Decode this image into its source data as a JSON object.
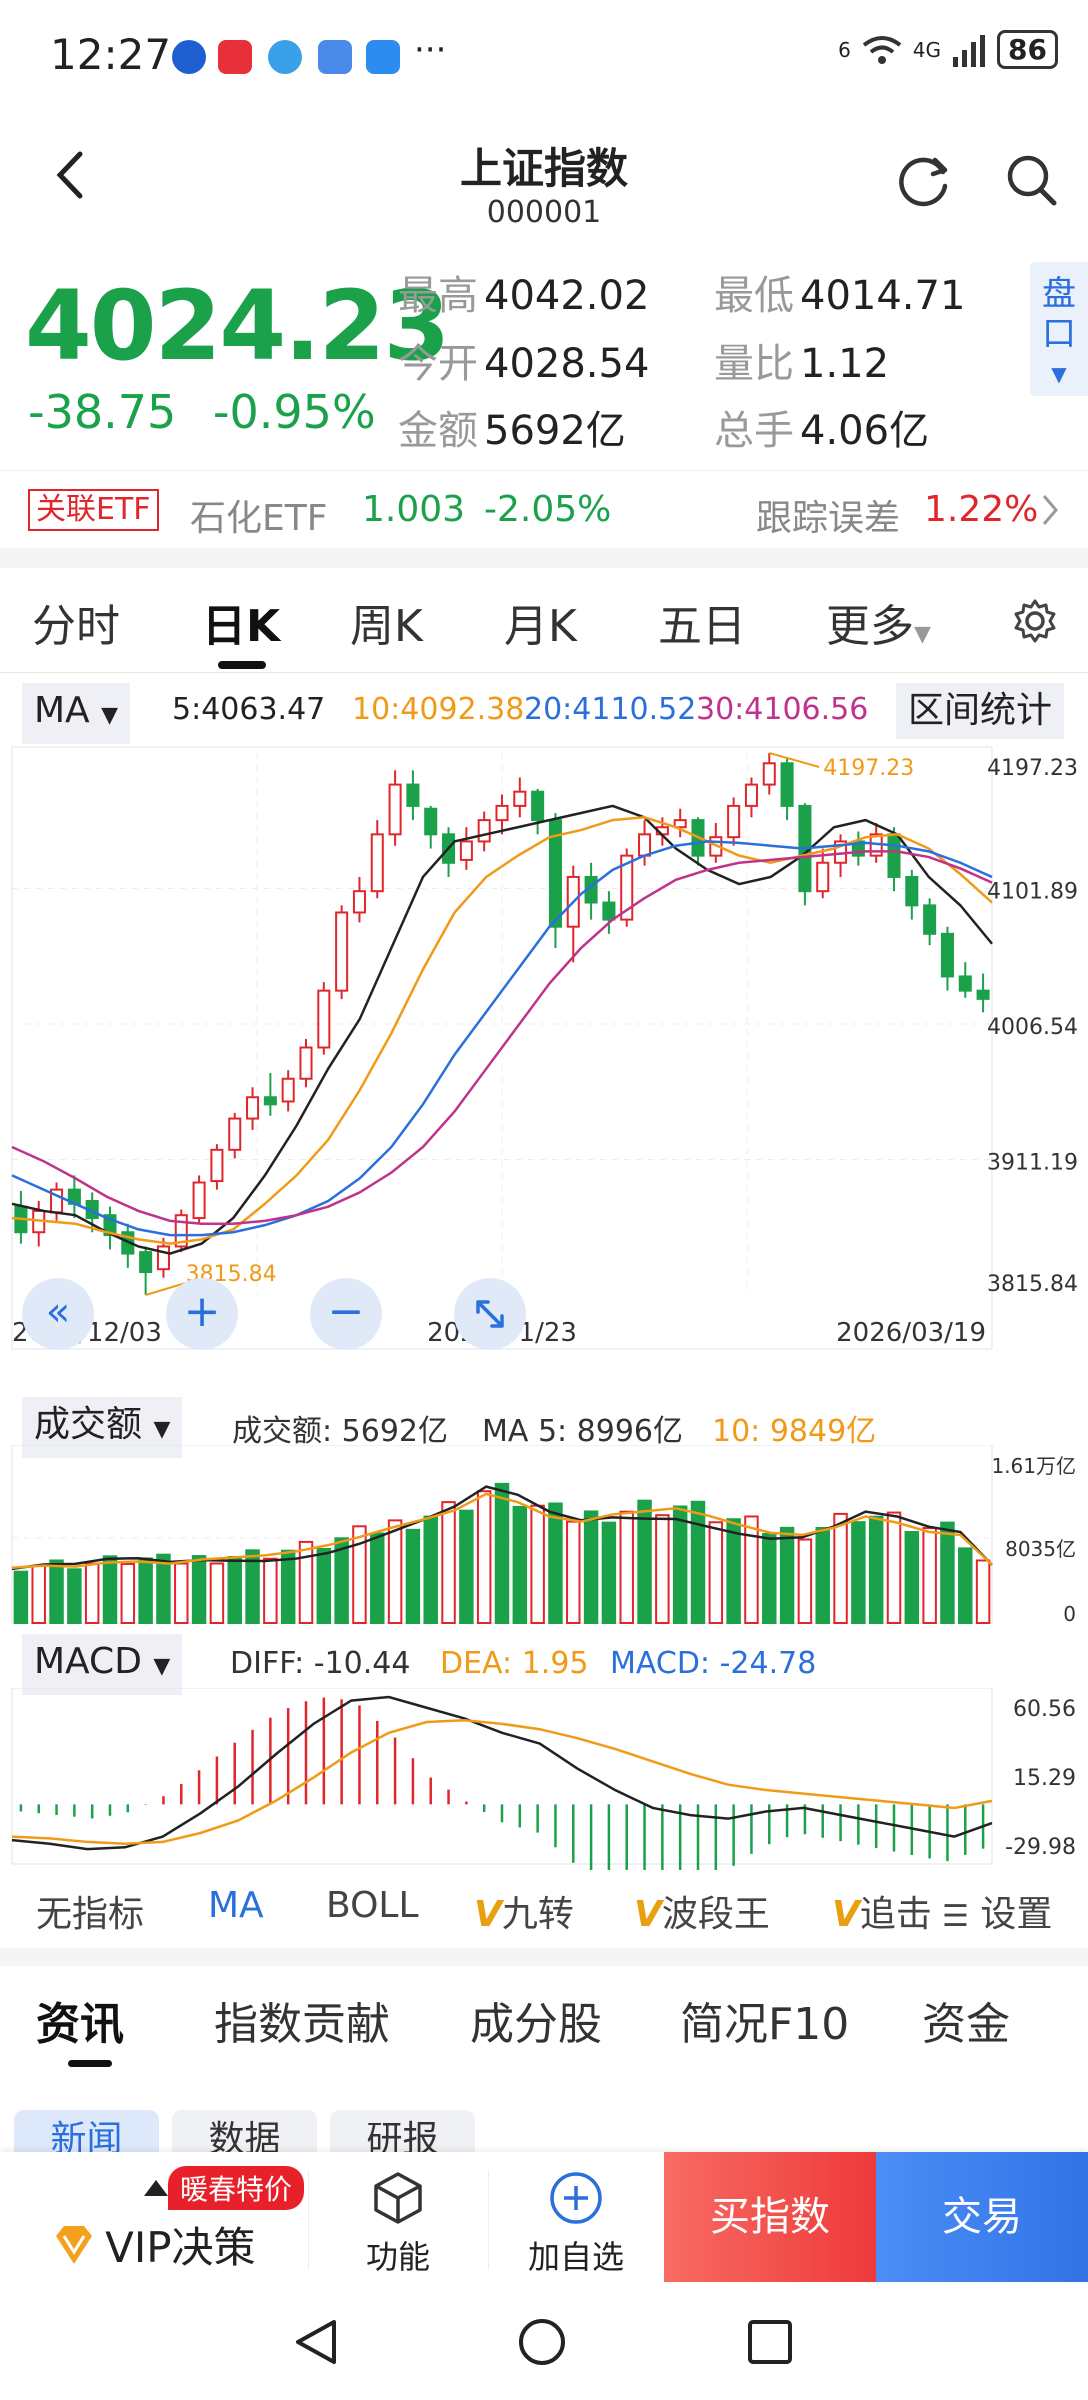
{
  "status_bar": {
    "time": "12:27",
    "more": "···",
    "net_badge": "6",
    "signal_label": "4G",
    "battery": "86"
  },
  "header": {
    "title": "上证指数",
    "code": "000001"
  },
  "quote": {
    "price": "4024.23",
    "change": "-38.75",
    "change_pct": "-0.95%",
    "high_label": "最高",
    "high": "4042.02",
    "low_label": "最低",
    "low": "4014.71",
    "open_label": "今开",
    "open": "4028.54",
    "volume_ratio_label": "量比",
    "volume_ratio": "1.12",
    "amount_label": "金额",
    "amount": "5692亿",
    "total_hands_label": "总手",
    "total_hands": "4.06亿",
    "pankou_label": "盘口"
  },
  "etf": {
    "tag": "关联ETF",
    "name": "石化ETF",
    "price": "1.003",
    "change_pct": "-2.05%",
    "tracking_label": "跟踪误差",
    "tracking_value": "1.22%"
  },
  "period_tabs": [
    "分时",
    "日K",
    "周K",
    "月K",
    "五日",
    "更多"
  ],
  "active_period": "日K",
  "ma_legend": {
    "selector": "MA",
    "ma5": "5:4063.47",
    "ma10": "10:4092.38",
    "ma20": "20:4110.52",
    "ma30": "30:4106.56",
    "range_stat": "区间统计"
  },
  "kline": {
    "y_labels": [
      "4197.23",
      "4101.89",
      "4006.54",
      "3911.19",
      "3815.84"
    ],
    "x_labels": [
      "2025/12/03",
      "2026/01/23",
      "2026/03/19"
    ],
    "max_annotation": "4197.23",
    "min_annotation": "3815.84"
  },
  "volume_legend": {
    "selector": "成交额",
    "amount": "成交额:  5692亿",
    "ma5": "MA 5:  8996亿",
    "ma10": "10:  9849亿",
    "y_labels": [
      "1.61万亿",
      "8035亿",
      "0"
    ]
  },
  "macd_legend": {
    "selector": "MACD",
    "diff": "DIFF:  -10.44",
    "dea": "DEA:  1.95",
    "macd": "MACD:  -24.78",
    "y_labels": [
      "60.56",
      "15.29",
      "-29.98"
    ]
  },
  "indicator_tabs": [
    "无指标",
    "MA",
    "BOLL",
    "九转",
    "波段王",
    "追击"
  ],
  "indicator_v_mark": "V",
  "indicator_settings": "设置",
  "news_tabs": [
    "资讯",
    "指数贡献",
    "成分股",
    "简况F10",
    "资金"
  ],
  "sub_tabs": [
    "新闻",
    "数据",
    "研报"
  ],
  "bottom_bar": {
    "promo": "暖春特价",
    "vip": "VIP决策",
    "function": "功能",
    "add_watch": "加自选",
    "buy": "买指数",
    "trade": "交易"
  },
  "colors": {
    "up": "#e0262b",
    "down": "#1aa14a",
    "ma5": "#222222",
    "ma10": "#f09a18",
    "ma20": "#2a6fdb",
    "ma30": "#c0338a"
  },
  "chart_data": [
    {
      "type": "line",
      "title": "上证指数 日K",
      "series": [
        {
          "name": "MA5",
          "values": [
            3880,
            3875,
            3872,
            3860,
            3850,
            3845,
            3852,
            3870,
            3900,
            3935,
            3975,
            4010,
            4060,
            4110,
            4135,
            4140,
            4145,
            4150,
            4155,
            4160,
            4152,
            4130,
            4115,
            4105,
            4110,
            4125,
            4145,
            4150,
            4140,
            4110,
            4090,
            4063
          ]
        },
        {
          "name": "MA10",
          "values": [
            3870,
            3868,
            3866,
            3860,
            3855,
            3852,
            3855,
            3862,
            3880,
            3900,
            3925,
            3960,
            4000,
            4045,
            4085,
            4110,
            4125,
            4138,
            4143,
            4150,
            4152,
            4145,
            4135,
            4125,
            4120,
            4125,
            4130,
            4138,
            4140,
            4130,
            4112,
            4092
          ]
        },
        {
          "name": "MA20",
          "values": [
            3900,
            3890,
            3880,
            3870,
            3862,
            3858,
            3858,
            3860,
            3865,
            3872,
            3882,
            3898,
            3920,
            3950,
            3985,
            4015,
            4045,
            4075,
            4098,
            4115,
            4125,
            4132,
            4135,
            4134,
            4132,
            4130,
            4132,
            4134,
            4132,
            4128,
            4120,
            4110
          ]
        },
        {
          "name": "MA30",
          "values": [
            3920,
            3910,
            3898,
            3885,
            3875,
            3868,
            3866,
            3866,
            3868,
            3872,
            3878,
            3888,
            3902,
            3920,
            3945,
            3975,
            4005,
            4035,
            4060,
            4080,
            4095,
            4108,
            4115,
            4120,
            4122,
            4124,
            4126,
            4128,
            4128,
            4124,
            4116,
            4106
          ]
        }
      ],
      "ylim": [
        3815.84,
        4197.23
      ]
    },
    {
      "type": "bar",
      "title": "成交额",
      "ylabel": "成交额",
      "ylim": [
        0,
        16100
      ],
      "values": [
        5400,
        5600,
        5500,
        5900,
        6000,
        5800,
        6200,
        6400,
        6600,
        7000,
        7600,
        8400,
        9300,
        10100,
        11000,
        12600,
        11800,
        10400,
        9900,
        10600,
        10900,
        11200,
        10500,
        9600,
        8800,
        8600,
        9300,
        10400,
        9800,
        8900,
        8600,
        5692
      ]
    },
    {
      "type": "bar",
      "title": "MACD",
      "series": [
        {
          "name": "DIFF",
          "values": [
            -20,
            -22,
            -25,
            -24,
            -18,
            -5,
            10,
            28,
            45,
            58,
            60,
            54,
            48,
            40,
            34,
            20,
            8,
            -2,
            -6,
            -8,
            -4,
            -2,
            -6,
            -10,
            -14,
            -18,
            -10.44
          ]
        },
        {
          "name": "DEA",
          "values": [
            -18,
            -19,
            -21,
            -22,
            -21,
            -16,
            -9,
            2,
            15,
            29,
            40,
            46,
            47,
            45,
            42,
            37,
            31,
            24,
            17,
            11,
            8,
            6,
            4,
            2,
            0,
            -2,
            1.95
          ]
        }
      ],
      "ylim": [
        -29.98,
        60.56
      ]
    }
  ]
}
